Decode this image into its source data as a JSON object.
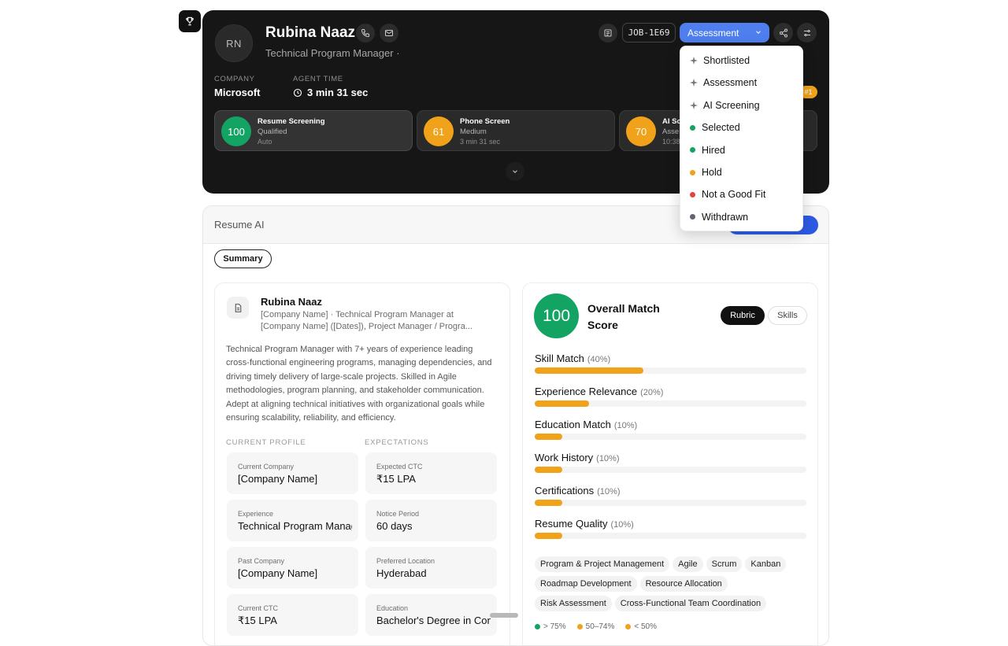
{
  "candidate": {
    "initials": "RN",
    "name": "Rubina Naaz",
    "role": "Technical Program Manager ·",
    "job_id": "JOB-1E69",
    "status_selected": "Assessment"
  },
  "meta": {
    "company_label": "COMPANY",
    "company_value": "Microsoft",
    "agent_time_label": "AGENT TIME",
    "agent_time_value": "3 min 31 sec",
    "rank_badge": "#1"
  },
  "stages": [
    {
      "score": "100",
      "title": "Resume Screening",
      "sub": "Qualified",
      "meta": "Auto",
      "color": "#13a463"
    },
    {
      "score": "61",
      "title": "Phone Screen",
      "sub": "Medium",
      "meta": "3 min 31 sec",
      "color": "#f0a21a"
    },
    {
      "score": "70",
      "title": "AI Sc",
      "sub": "Asse",
      "meta": "10:38",
      "color": "#f0a21a"
    }
  ],
  "status_menu": [
    {
      "label": "Shortlisted",
      "kind": "sparkle"
    },
    {
      "label": "Assessment",
      "kind": "sparkle"
    },
    {
      "label": "AI Screening",
      "kind": "sparkle"
    },
    {
      "label": "Selected",
      "kind": "dot",
      "color": "#13a463"
    },
    {
      "label": "Hired",
      "kind": "dot",
      "color": "#13a463"
    },
    {
      "label": "Hold",
      "kind": "dot",
      "color": "#f0a21a"
    },
    {
      "label": "Not a Good Fit",
      "kind": "dot",
      "color": "#e0443e"
    },
    {
      "label": "Withdrawn",
      "kind": "dot",
      "color": "#5e6470"
    }
  ],
  "resume": {
    "section_title": "Resume AI",
    "tab_summary": "Summary",
    "name": "Rubina Naaz",
    "headline": "[Company Name] · Technical Program Manager at [Company Name] ([Dates]), Project Manager / Progra...",
    "bio": "Technical Program Manager with 7+ years of experience leading cross-functional engineering programs, managing dependencies, and driving timely delivery of large-scale projects. Skilled in Agile methodologies, program planning, and stakeholder communication. Adept at aligning technical initiatives with organizational goals while ensuring scalability, reliability, and efficiency.",
    "current_profile_heading": "CURRENT PROFILE",
    "expectations_heading": "EXPECTATIONS",
    "current_profile": [
      {
        "label": "Current Company",
        "value": "[Company Name]"
      },
      {
        "label": "Experience",
        "value": "Technical Program Manager"
      },
      {
        "label": "Past Company",
        "value": "[Company Name]"
      },
      {
        "label": "Current CTC",
        "value": "₹15 LPA"
      }
    ],
    "expectations": [
      {
        "label": "Expected CTC",
        "value": "₹15 LPA"
      },
      {
        "label": "Notice Period",
        "value": "60 days"
      },
      {
        "label": "Preferred Location",
        "value": "Hyderabad"
      },
      {
        "label": "Education",
        "value": "Bachelor's Degree in Computer Science"
      }
    ]
  },
  "match": {
    "score": "100",
    "title": "Overall Match Score",
    "tab_rubric": "Rubric",
    "tab_skills": "Skills",
    "criteria": [
      {
        "name": "Skill Match",
        "weight": "(40%)",
        "fill": 0.4
      },
      {
        "name": "Experience Relevance",
        "weight": "(20%)",
        "fill": 0.2
      },
      {
        "name": "Education Match",
        "weight": "(10%)",
        "fill": 0.1
      },
      {
        "name": "Work History",
        "weight": "(10%)",
        "fill": 0.1
      },
      {
        "name": "Certifications",
        "weight": "(10%)",
        "fill": 0.1
      },
      {
        "name": "Resume Quality",
        "weight": "(10%)",
        "fill": 0.1
      }
    ],
    "skills": [
      "Program & Project Management",
      "Agile",
      "Scrum",
      "Kanban",
      "Roadmap Development",
      "Resource Allocation",
      "Risk Assessment",
      "Cross-Functional Team Coordination"
    ],
    "legend": [
      {
        "label": "> 75%",
        "color": "#13a463"
      },
      {
        "label": "50–74%",
        "color": "#f0a21a"
      },
      {
        "label": "< 50%",
        "color": "#f0a21a"
      }
    ]
  }
}
